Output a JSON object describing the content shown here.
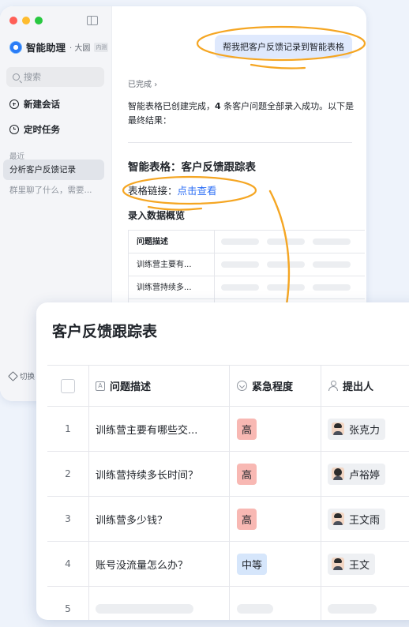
{
  "sidebar": {
    "traffic": {
      "close": "#ff5f57",
      "minimize": "#febc2e",
      "zoom": "#28c840"
    },
    "brand": {
      "name": "智能助理",
      "sub": "· 大圆",
      "tag": "内测"
    },
    "search_placeholder": "搜索",
    "new_chat": "新建会话",
    "scheduled": "定时任务",
    "recent_label": "最近",
    "recent_items": [
      "分析客户反馈记录",
      "群里聊了什么，需要..."
    ],
    "switch_label": "切换"
  },
  "chat": {
    "user_message": "帮我把客户反馈记录到智能表格",
    "status": "已完成",
    "reply_part1": "智能表格已创建完成，",
    "reply_count": "4",
    "reply_part2": " 条客户问题全部录入成功。以下是最终结果：",
    "table_title": "智能表格：客户反馈跟踪表",
    "link_label": "表格链接：",
    "link_text": "点击查看",
    "overview_title": "录入数据概览",
    "mini_header": "问题描述",
    "mini_rows": [
      "训练营主要有...",
      "训练营持续多..."
    ]
  },
  "sheet": {
    "title": "客户反馈跟踪表",
    "columns": {
      "desc": "问题描述",
      "urgency": "紧急程度",
      "reporter": "提出人"
    },
    "rows": [
      {
        "no": "1",
        "desc": "训练营主要有哪些交...",
        "urgency": "高",
        "reporter": "张克力"
      },
      {
        "no": "2",
        "desc": "训练营持续多长时间？",
        "urgency": "高",
        "reporter": "卢裕婷"
      },
      {
        "no": "3",
        "desc": "训练营多少钱？",
        "urgency": "高",
        "reporter": "王文雨"
      },
      {
        "no": "4",
        "desc": "账号没流量怎么办？",
        "urgency": "中等",
        "reporter": "王文"
      },
      {
        "no": "5"
      }
    ]
  },
  "colors": {
    "accent": "#f5a623",
    "link": "#2b6ef6",
    "tag_high": "#f8b8b3",
    "tag_mid": "#d6e6fb"
  }
}
